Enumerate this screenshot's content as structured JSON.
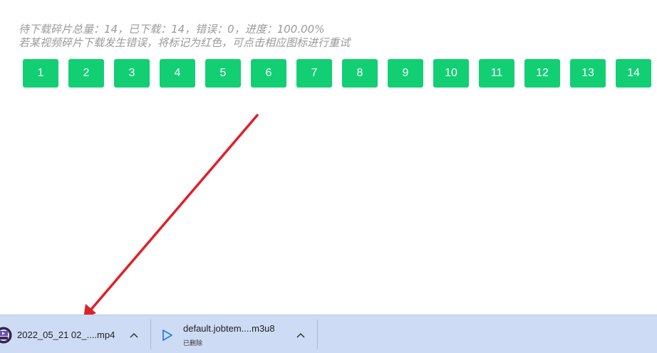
{
  "progress": {
    "summary": "待下载碎片总量：14，已下载：14，错误：0，进度：100.00%",
    "hint": "若某视频碎片下载发生错误，将标记为红色，可点击相应图标进行重试",
    "total": 14,
    "downloaded": 14,
    "errors": 0,
    "percent": 100.0
  },
  "segments": [
    "1",
    "2",
    "3",
    "4",
    "5",
    "6",
    "7",
    "8",
    "9",
    "10",
    "11",
    "12",
    "13",
    "14"
  ],
  "colors": {
    "segment_ok": "#12cf74",
    "arrow": "#e0202a",
    "download_bar": "#cddcf4"
  },
  "downloads": [
    {
      "name": "2022_05_21 02_....mp4",
      "icon": "mp4-file-icon"
    },
    {
      "name": "default.jobtem....m3u8",
      "status": "已删除",
      "icon": "play-icon"
    }
  ]
}
